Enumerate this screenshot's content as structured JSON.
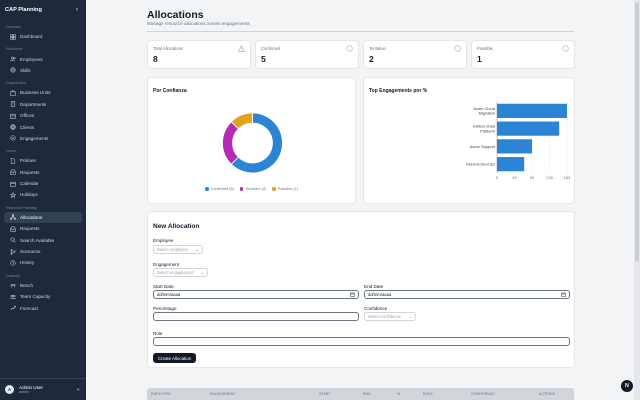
{
  "app": {
    "title": "CAP Planning"
  },
  "sidebar": {
    "sections": [
      {
        "title": "Overview",
        "items": [
          {
            "label": "Dashboard",
            "icon": "grid-icon"
          }
        ]
      },
      {
        "title": "Workforce",
        "items": [
          {
            "label": "Employees",
            "icon": "users-icon"
          },
          {
            "label": "Skills",
            "icon": "gear-icon"
          }
        ]
      },
      {
        "title": "Organization",
        "items": [
          {
            "label": "Business Units",
            "icon": "briefcase-icon"
          },
          {
            "label": "Departments",
            "icon": "building-icon"
          },
          {
            "label": "Offices",
            "icon": "office-icon"
          },
          {
            "label": "Clients",
            "icon": "globe-icon"
          },
          {
            "label": "Engagements",
            "icon": "handshake-icon"
          }
        ]
      },
      {
        "title": "Leave",
        "items": [
          {
            "label": "Policies",
            "icon": "document-icon"
          },
          {
            "label": "Requests",
            "icon": "inbox-icon"
          },
          {
            "label": "Calendar",
            "icon": "calendar-icon"
          },
          {
            "label": "Holidays",
            "icon": "holiday-icon"
          }
        ]
      },
      {
        "title": "Resource Planning",
        "items": [
          {
            "label": "Allocations",
            "icon": "network-icon",
            "active": true
          },
          {
            "label": "Requests",
            "icon": "inbox-icon"
          },
          {
            "label": "Search Available",
            "icon": "search-icon"
          },
          {
            "label": "Scenarios",
            "icon": "branch-icon"
          },
          {
            "label": "History",
            "icon": "history-icon"
          }
        ]
      },
      {
        "title": "Capacity",
        "items": [
          {
            "label": "Bench",
            "icon": "bench-icon"
          },
          {
            "label": "Team Capacity",
            "icon": "team-icon"
          },
          {
            "label": "Forecast",
            "icon": "trend-icon"
          }
        ]
      }
    ],
    "user": {
      "initials": "A",
      "name": "Admin User",
      "role": "admin"
    }
  },
  "page": {
    "title": "Allocations",
    "subtitle": "Manage resource allocations across engagements"
  },
  "kpis": [
    {
      "label": "Total Allocations",
      "value": "8",
      "icon": "warning-icon"
    },
    {
      "label": "Confirmed",
      "value": "5",
      "icon": "info-icon"
    },
    {
      "label": "Tentative",
      "value": "2",
      "icon": "info-icon"
    },
    {
      "label": "Possible",
      "value": "1",
      "icon": "info-icon"
    }
  ],
  "colors": {
    "confirmed": "#2b84d6",
    "tentative": "#b62bb6",
    "possible": "#e3a21a",
    "bar": "#2b84d6"
  },
  "chart_data": [
    {
      "type": "pie",
      "title": "Por Confianza",
      "categories": [
        "Confirmed",
        "Tentative",
        "Possible"
      ],
      "values": [
        5,
        2,
        1
      ],
      "legend": [
        "Confirmed (5)",
        "Tentative (2)",
        "Possible (1)"
      ],
      "legend_position": "bottom"
    },
    {
      "type": "bar",
      "orientation": "horizontal",
      "title": "Top Engagements por %",
      "categories": [
        "Acme Cloud Migration",
        "Globex Data Platform",
        "Acme Support",
        "Internal DevOps"
      ],
      "category_lines": [
        [
          "Acme Cloud",
          "Migration"
        ],
        [
          "Globex Data",
          "Platform"
        ],
        [
          "Acme Support"
        ],
        [
          "Internal DevOps"
        ]
      ],
      "values": [
        180,
        160,
        90,
        70
      ],
      "xlim": [
        0,
        180
      ],
      "xticks": [
        "0",
        "45",
        "90",
        "135",
        "180"
      ],
      "grid": true
    }
  ],
  "form": {
    "title": "New Allocation",
    "employee_label": "Employee",
    "employee_placeholder": "Select employee",
    "engagement_label": "Engagement",
    "engagement_placeholder": "Select engagement",
    "start_label": "Start Date",
    "start_placeholder": "dd/mm/aaaa",
    "end_label": "End Date",
    "end_placeholder": "dd/mm/aaaa",
    "percentage_label": "Percentage",
    "confidence_label": "Confidence",
    "confidence_placeholder": "Select confidence",
    "role_label": "Role",
    "submit_label": "Create Allocation"
  },
  "table": {
    "columns": [
      "EMPLOYEE",
      "ENGAGEMENT",
      "START",
      "END",
      "%",
      "ROLE",
      "CONFIDENCE",
      "ACTIONS"
    ]
  },
  "fab_label": "N"
}
